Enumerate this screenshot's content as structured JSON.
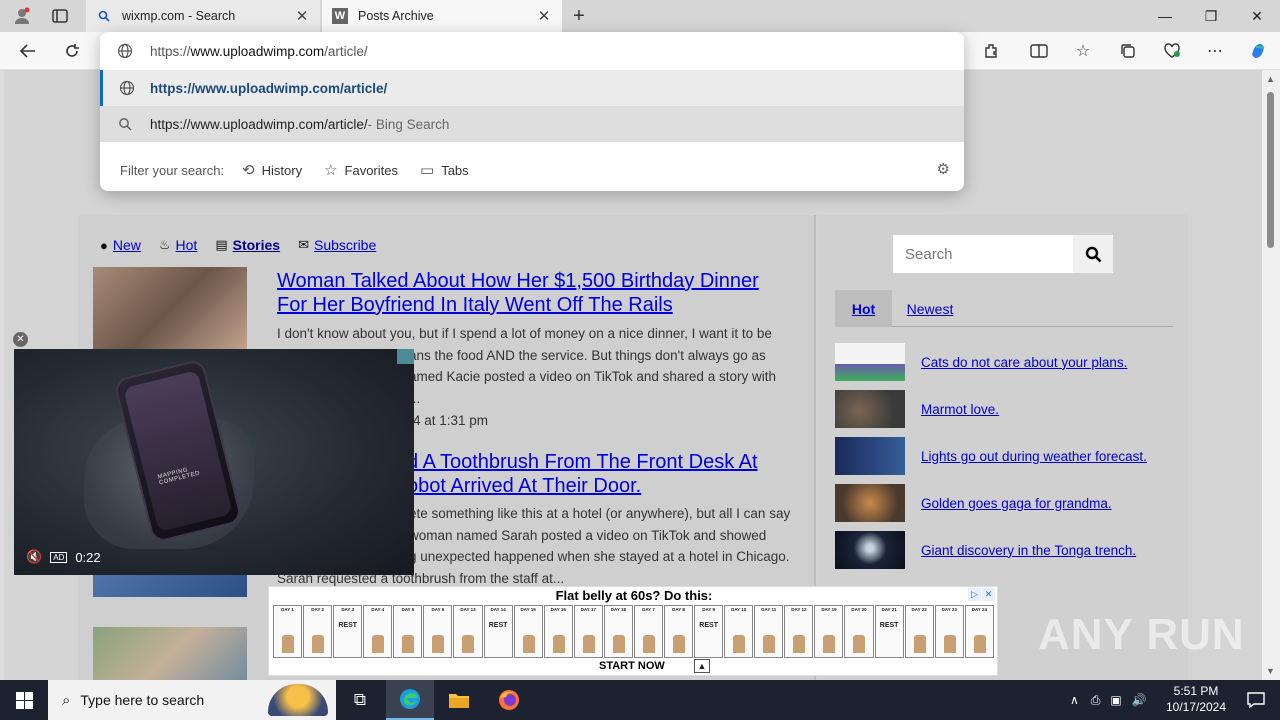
{
  "tabs": [
    {
      "title": "wixmp.com - Search",
      "favicon": "search-icon"
    },
    {
      "title": "Posts Archive",
      "favicon": "w-logo-icon"
    }
  ],
  "omnibox": {
    "input_prefix": "https://",
    "input_domain": "www.uploadwimp.com",
    "input_path": "/article/",
    "suggestion_url": "https://www.uploadwimp.com/article/",
    "bing_query": "https://www.uploadwimp.com/article/",
    "bing_suffix": " - Bing Search",
    "filter_label": "Filter your search:",
    "filters": [
      "History",
      "Favorites",
      "Tabs"
    ]
  },
  "nav": {
    "new": "New",
    "hot": "Hot",
    "stories": "Stories",
    "subscribe": "Subscribe"
  },
  "stories": [
    {
      "title_line1": "Woman Talked About How Her $1,500 Birthday Dinner",
      "title_line2": "For Her Boyfriend In Italy Went Off The Rails",
      "text_line1": "I don't know about you, but if I spend a lot of money on a nice dinner, I want it to be",
      "text_line2": "ans the food AND the service. But things don't always go as",
      "text_line3": "amed Kacie posted a video on TikTok and shared a story with",
      "text_line4": "...",
      "date": "4 at 1:31 pm"
    },
    {
      "title_line1": "d A Toothbrush From The Front Desk At",
      "title_line2": "obot Arrived At Their Door.",
      "text_line1": "ete something like this at a hotel (or anywhere), but all I can say",
      "text_line2": "woman named Sarah posted a video on TikTok and showed",
      "text_line3": "g unexpected happened when she stayed at a hotel in Chicago.",
      "text_line4": "Sarah requested a toothbrush from the staff at..."
    }
  ],
  "sidebar": {
    "search_placeholder": "Search",
    "tab_hot": "Hot",
    "tab_newest": "Newest",
    "items": [
      {
        "label": "Cats do not care about your plans."
      },
      {
        "label": "Marmot love."
      },
      {
        "label": "Lights go out during weather forecast."
      },
      {
        "label": "Golden goes gaga for grandma."
      },
      {
        "label": "Giant discovery in the Tonga trench."
      }
    ]
  },
  "video": {
    "time": "0:22",
    "ad_label": "AD",
    "screen_text": "MAPPING COMPLETED"
  },
  "banner": {
    "headline": "Flat belly at 60s? Do this:",
    "cta": "START NOW",
    "days": [
      "DAY 1",
      "DAY 2",
      "DAY 3",
      "DAY 4",
      "DAY 5",
      "DAY 6",
      "DAY 13",
      "DAY 14",
      "DAY 15",
      "DAY 16",
      "DAY 17",
      "DAY 18",
      "DAY 7",
      "DAY 8",
      "DAY 9",
      "DAY 10",
      "DAY 11",
      "DAY 12",
      "DAY 19",
      "DAY 20",
      "DAY 21",
      "DAY 22",
      "DAY 23",
      "DAY 24"
    ],
    "rest_label": "REST"
  },
  "watermark": "ANY RUN",
  "taskbar": {
    "search_placeholder": "Type here to search",
    "time": "5:51 PM",
    "date": "10/17/2024"
  }
}
